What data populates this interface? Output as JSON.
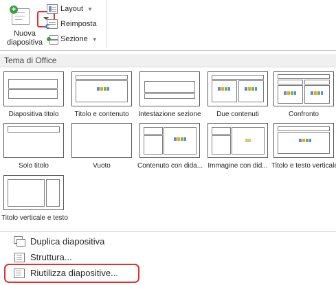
{
  "ribbon": {
    "new_slide_label": "Nuova diapositiva",
    "layout_label": "Layout",
    "reset_label": "Reimposta",
    "section_label": "Sezione"
  },
  "gallery": {
    "header": "Tema di Office",
    "layouts": [
      {
        "label": "Diapositiva titolo"
      },
      {
        "label": "Titolo e contenuto"
      },
      {
        "label": "Intestazione sezione"
      },
      {
        "label": "Due contenuti"
      },
      {
        "label": "Confronto"
      },
      {
        "label": "Solo titolo"
      },
      {
        "label": "Vuoto"
      },
      {
        "label": "Contenuto con dida..."
      },
      {
        "label": "Immagine con did..."
      },
      {
        "label": "Titolo e testo verticale"
      },
      {
        "label": "Titolo verticale e testo"
      }
    ]
  },
  "menu": {
    "duplicate": "Duplica diapositiva",
    "outline": "Struttura...",
    "reuse": "Riutilizza diapositive..."
  },
  "colors": {
    "highlight": "#e03030",
    "accent_green": "#3aa143"
  }
}
